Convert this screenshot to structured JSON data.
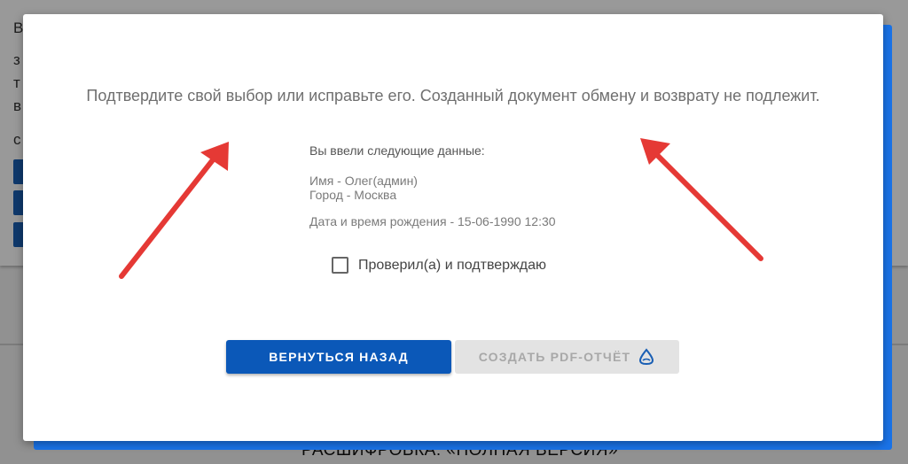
{
  "background": {
    "letters": [
      "В",
      "з",
      "т",
      "в",
      "с"
    ],
    "bottom_text": "РАСШИФРОВКА: «ПОЛНАЯ ВЕРСИЯ»"
  },
  "dialog": {
    "message": "Подтвердите свой выбор или исправьте его. Созданный документ обмену и возврату не подлежит.",
    "summary_heading": "Вы ввели следующие данные:",
    "name_line": "Имя - Олег(админ)",
    "city_line": "Город - Москва",
    "birth_line": "Дата и время рождения - 15-06-1990 12:30",
    "confirm_checkbox": {
      "label": "Проверил(а) и подтверждаю",
      "checked": false
    },
    "buttons": {
      "back_label": "ВЕРНУТЬСЯ НАЗАД",
      "pdf_label": "СОЗДАТЬ PDF-ОТЧЁТ",
      "pdf_icon": "loading-spinner-icon",
      "pdf_disabled": true
    }
  },
  "colors": {
    "primary": "#0b58b8",
    "accent": "#1a73e8",
    "annotation_arrow": "#e53935",
    "disabled_bg": "#e3e3e3",
    "disabled_text": "#a8a8a8"
  }
}
